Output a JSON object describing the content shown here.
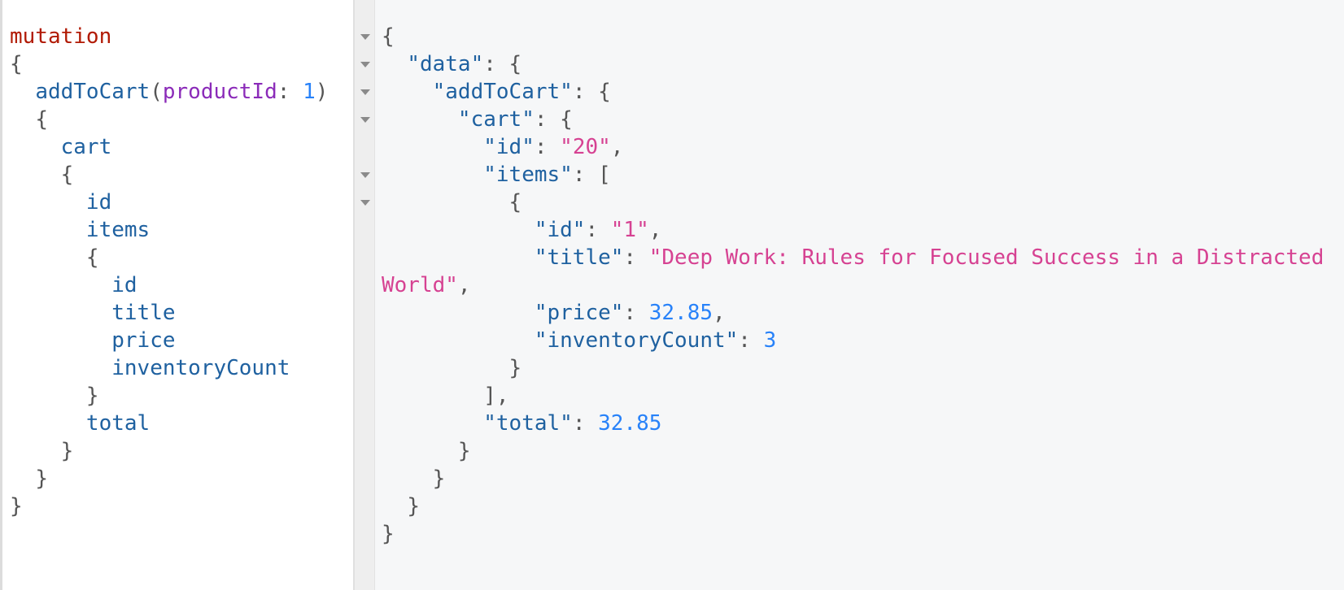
{
  "query": {
    "keyword": "mutation",
    "brace_open": "{",
    "brace_close": "}",
    "field_add_to_cart": "addToCart",
    "arg_name": "productId",
    "arg_value": "1",
    "field_cart": "cart",
    "field_id": "id",
    "field_items": "items",
    "field_title": "title",
    "field_price": "price",
    "field_inventory": "inventoryCount",
    "field_total": "total"
  },
  "result": {
    "key_data": "\"data\"",
    "key_add_to_cart": "\"addToCart\"",
    "key_cart": "\"cart\"",
    "key_id": "\"id\"",
    "cart_id": "\"20\"",
    "key_items": "\"items\"",
    "item_id": "\"1\"",
    "key_title": "\"title\"",
    "item_title_part1": "\"Deep Work: Rules for Focused Success in a Distracted",
    "item_title_part2": "World\"",
    "key_price": "\"price\"",
    "item_price": "32.85",
    "key_inventory": "\"inventoryCount\"",
    "item_inventory": "3",
    "key_total": "\"total\"",
    "cart_total": "32.85"
  },
  "fold_markers": [
    "chevron-down-icon",
    "chevron-down-icon",
    "chevron-down-icon",
    "chevron-down-icon",
    "chevron-down-icon",
    "chevron-down-icon"
  ]
}
